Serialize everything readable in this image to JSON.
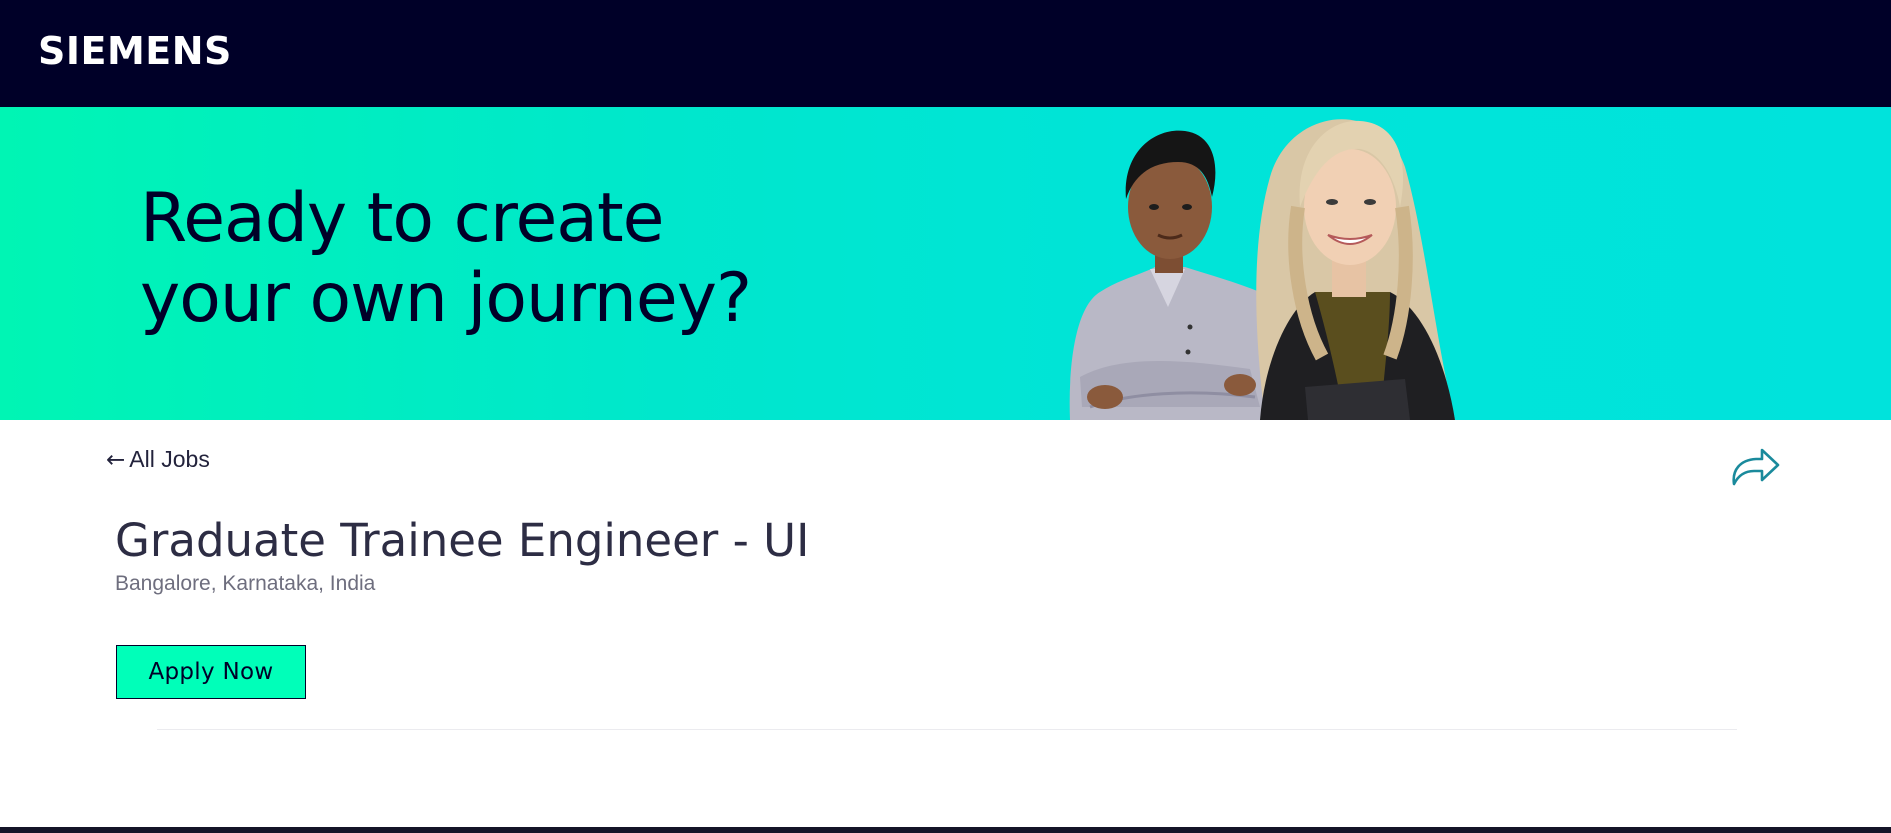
{
  "header": {
    "logo_text": "SIEMENS",
    "background_color": "#000028"
  },
  "hero": {
    "headline_line1": "Ready to create",
    "headline_line2": "your own journey?",
    "gradient_start": "#00f5b4",
    "gradient_end": "#00e3dc",
    "image": "two-people-portrait"
  },
  "nav": {
    "back_arrow": "←",
    "back_label": "All Jobs",
    "share_icon": "share-arrow-icon"
  },
  "job": {
    "title": "Graduate Trainee Engineer - UI",
    "location": "Bangalore, Karnataka, India",
    "apply_label": "Apply Now",
    "apply_color": "#00ffb9"
  }
}
